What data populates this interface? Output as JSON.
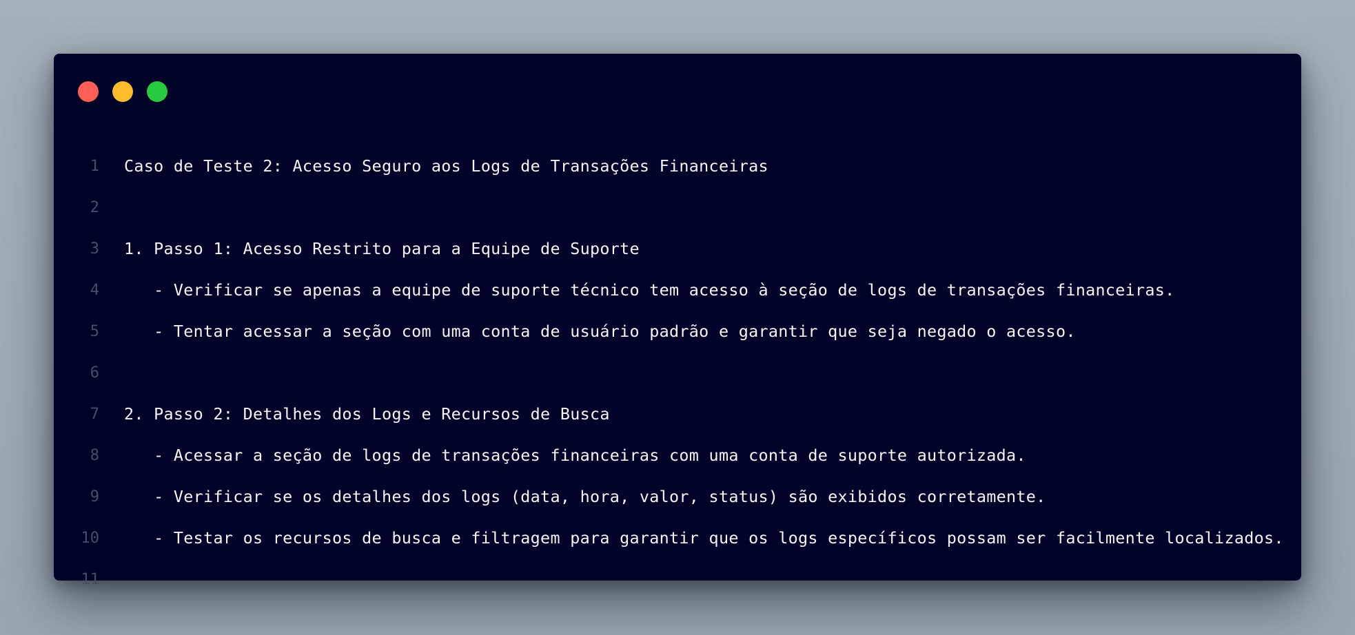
{
  "window": {
    "controls": [
      "close",
      "minimize",
      "maximize"
    ],
    "colors": {
      "background": "#010228",
      "close": "#ff5f56",
      "minimize": "#ffbd2e",
      "maximize": "#27c93f",
      "text": "#f4f5f8",
      "line_number": "#4a4d66"
    }
  },
  "code": {
    "lines": [
      {
        "num": "1",
        "text": "Caso de Teste 2: Acesso Seguro aos Logs de Transações Financeiras"
      },
      {
        "num": "2",
        "text": ""
      },
      {
        "num": "3",
        "text": "1. Passo 1: Acesso Restrito para a Equipe de Suporte"
      },
      {
        "num": "4",
        "text": "   - Verificar se apenas a equipe de suporte técnico tem acesso à seção de logs de transações financeiras."
      },
      {
        "num": "5",
        "text": "   - Tentar acessar a seção com uma conta de usuário padrão e garantir que seja negado o acesso."
      },
      {
        "num": "6",
        "text": ""
      },
      {
        "num": "7",
        "text": "2. Passo 2: Detalhes dos Logs e Recursos de Busca"
      },
      {
        "num": "8",
        "text": "   - Acessar a seção de logs de transações financeiras com uma conta de suporte autorizada."
      },
      {
        "num": "9",
        "text": "   - Verificar se os detalhes dos logs (data, hora, valor, status) são exibidos corretamente."
      },
      {
        "num": "10",
        "text": "   - Testar os recursos de busca e filtragem para garantir que os logs específicos possam ser facilmente localizados."
      },
      {
        "num": "11",
        "text": ""
      }
    ]
  }
}
